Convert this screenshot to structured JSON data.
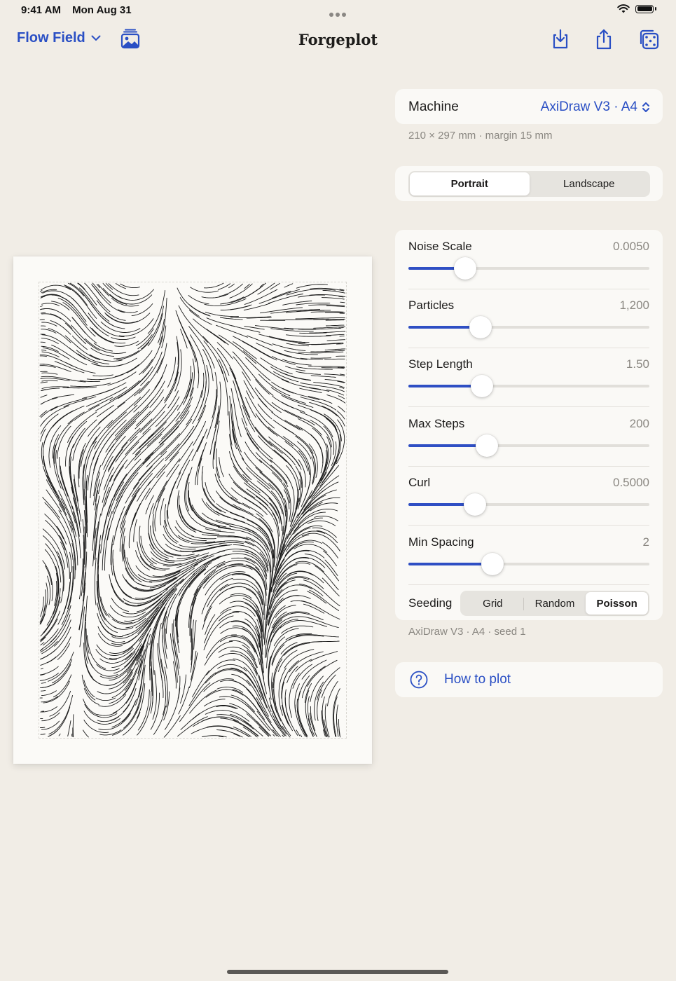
{
  "status_bar": {
    "time": "9:41 AM",
    "date": "Mon Aug 31"
  },
  "toolbar": {
    "document_menu": "Flow Field",
    "title": "Forgeplot",
    "icons": [
      "chevron-down-icon",
      "photo-stack-icon",
      "download-icon",
      "share-icon",
      "dice-icon"
    ]
  },
  "machine": {
    "label": "Machine",
    "value": "AxiDraw V3 · A4",
    "caption": "210 × 297 mm · margin 15 mm"
  },
  "orientation": {
    "options": [
      "Portrait",
      "Landscape"
    ],
    "selected": "Portrait"
  },
  "params": [
    {
      "label": "Noise Scale",
      "value": "0.0050",
      "fraction": 0.235
    },
    {
      "label": "Particles",
      "value": "1,200",
      "fraction": 0.3
    },
    {
      "label": "Step Length",
      "value": "1.50",
      "fraction": 0.305
    },
    {
      "label": "Max Steps",
      "value": "200",
      "fraction": 0.325
    },
    {
      "label": "Curl",
      "value": "0.5000",
      "fraction": 0.275
    },
    {
      "label": "Min Spacing",
      "value": "2",
      "fraction": 0.35
    }
  ],
  "seeding": {
    "label": "Seeding",
    "options": [
      "Grid",
      "Random",
      "Poisson"
    ],
    "selected": "Poisson"
  },
  "footer_caption": "AxiDraw V3 · A4 · seed 1",
  "help": {
    "label": "How to plot"
  },
  "colors": {
    "accent": "#2a4fc4",
    "background": "#f1ede6",
    "card": "#faf9f6",
    "ink": "#1a1a1a"
  }
}
